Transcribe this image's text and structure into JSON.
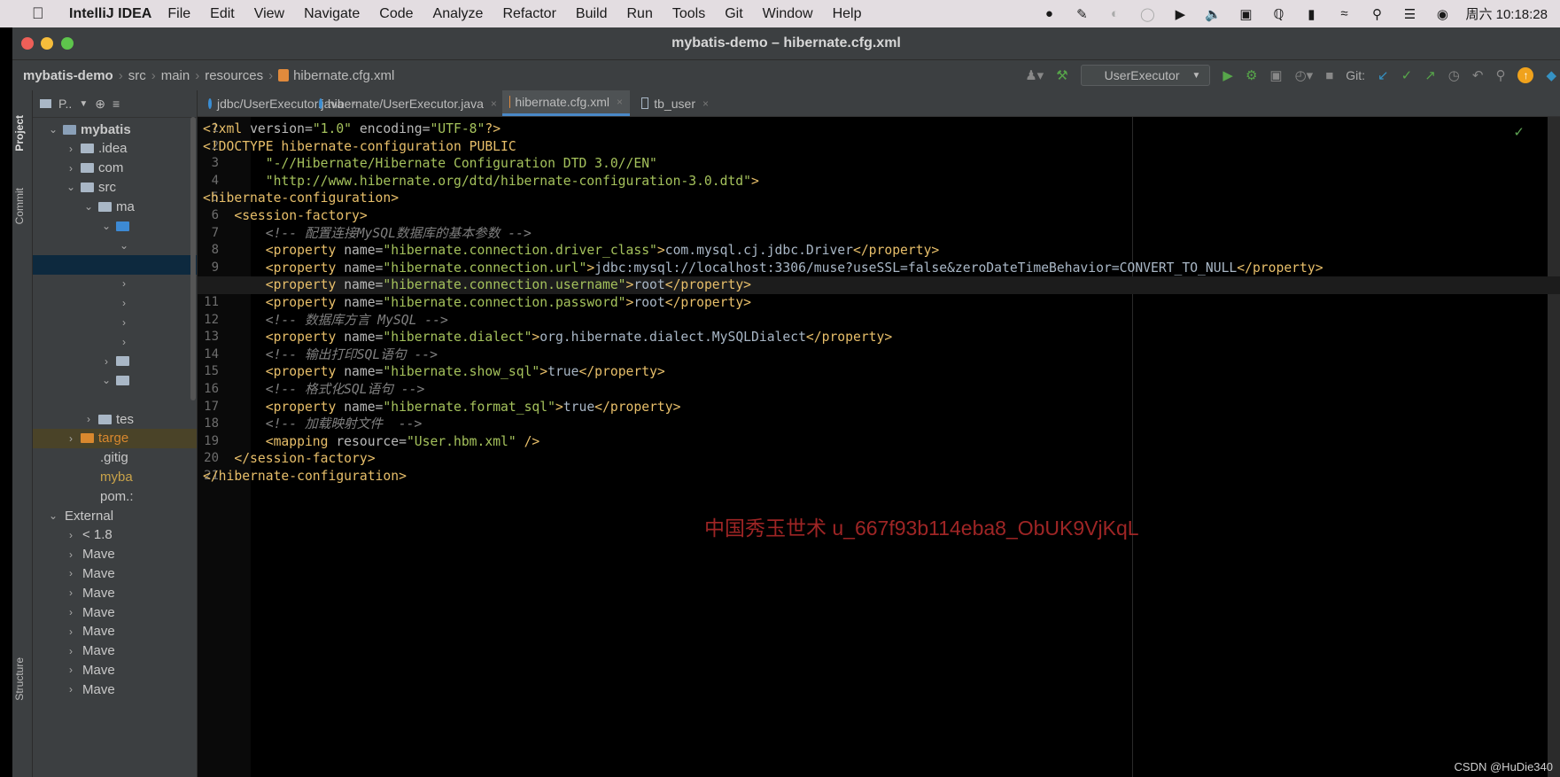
{
  "menubar": {
    "app": "IntelliJ IDEA",
    "items": [
      "File",
      "Edit",
      "View",
      "Navigate",
      "Code",
      "Analyze",
      "Refactor",
      "Build",
      "Run",
      "Tools",
      "Git",
      "Window",
      "Help"
    ],
    "clock": "周六 10:18:28"
  },
  "window": {
    "title": "mybatis-demo – hibernate.cfg.xml",
    "breadcrumbs": [
      "mybatis-demo",
      "src",
      "main",
      "resources",
      "hibernate.cfg.xml"
    ],
    "run_config": "UserExecutor",
    "git_label": "Git:"
  },
  "left_strip": {
    "project": "Project",
    "commit": "Commit",
    "structure": "Structure"
  },
  "project_panel": {
    "header": "P..",
    "rows": [
      {
        "label": "mybatis",
        "arrow": "v",
        "indent": 1,
        "folder": "mod"
      },
      {
        "label": ".idea",
        "arrow": ">",
        "indent": 2,
        "folder": "plain"
      },
      {
        "label": "com",
        "arrow": ">",
        "indent": 2,
        "folder": "plain"
      },
      {
        "label": "src",
        "arrow": "v",
        "indent": 2,
        "folder": "plain"
      },
      {
        "label": "ma",
        "arrow": "v",
        "indent": 3,
        "folder": "plain"
      },
      {
        "label": "",
        "arrow": "v",
        "indent": 4,
        "folder": "blue"
      },
      {
        "label": "",
        "arrow": "v",
        "indent": 5,
        "folder": "none"
      },
      {
        "label": "",
        "arrow": "",
        "indent": 5,
        "folder": "none"
      },
      {
        "label": "",
        "arrow": ">",
        "indent": 5,
        "folder": "none"
      },
      {
        "label": "",
        "arrow": ">",
        "indent": 5,
        "folder": "none"
      },
      {
        "label": "",
        "arrow": ">",
        "indent": 5,
        "folder": "none"
      },
      {
        "label": "",
        "arrow": ">",
        "indent": 5,
        "folder": "none"
      },
      {
        "label": "",
        "arrow": ">",
        "indent": 4,
        "folder": "plain"
      },
      {
        "label": "",
        "arrow": "v",
        "indent": 4,
        "folder": "plain"
      },
      {
        "label": "",
        "arrow": "",
        "indent": 4,
        "folder": "none"
      },
      {
        "label": "tes",
        "arrow": ">",
        "indent": 3,
        "folder": "plain"
      },
      {
        "label": "targe",
        "arrow": ">",
        "indent": 2,
        "folder": "orange"
      },
      {
        "label": ".gitig",
        "arrow": "",
        "indent": 3,
        "folder": "none"
      },
      {
        "label": "myba",
        "arrow": "",
        "indent": 3,
        "folder": "none"
      },
      {
        "label": "pom.:",
        "arrow": "",
        "indent": 3,
        "folder": "none"
      },
      {
        "label": "External",
        "arrow": "v",
        "indent": 1,
        "folder": "none"
      },
      {
        "label": "< 1.8",
        "arrow": ">",
        "indent": 2,
        "folder": "none"
      },
      {
        "label": "Mave",
        "arrow": ">",
        "indent": 2,
        "folder": "none"
      },
      {
        "label": "Mave",
        "arrow": ">",
        "indent": 2,
        "folder": "none"
      },
      {
        "label": "Mave",
        "arrow": ">",
        "indent": 2,
        "folder": "none"
      },
      {
        "label": "Mave",
        "arrow": ">",
        "indent": 2,
        "folder": "none"
      },
      {
        "label": "Mave",
        "arrow": ">",
        "indent": 2,
        "folder": "none"
      },
      {
        "label": "Mave",
        "arrow": ">",
        "indent": 2,
        "folder": "none"
      },
      {
        "label": "Mave",
        "arrow": ">",
        "indent": 2,
        "folder": "none"
      },
      {
        "label": "Mave",
        "arrow": ">",
        "indent": 2,
        "folder": "none"
      }
    ]
  },
  "tabs": [
    {
      "label": "jdbc/UserExecutor.java",
      "type": "java",
      "active": false
    },
    {
      "label": "hibernate/UserExecutor.java",
      "type": "java",
      "active": false
    },
    {
      "label": "hibernate.cfg.xml",
      "type": "xml",
      "active": true
    },
    {
      "label": "tb_user",
      "type": "table",
      "active": false
    }
  ],
  "editor": {
    "current_line": 10,
    "lines": [
      [
        [
          "tag",
          "<?xml "
        ],
        [
          "attr",
          "version="
        ],
        [
          "val",
          "\"1.0\""
        ],
        [
          "attr",
          " encoding="
        ],
        [
          "val",
          "\"UTF-8\""
        ],
        [
          "tag",
          "?>"
        ]
      ],
      [
        [
          "tag",
          "<!DOCTYPE hibernate-configuration PUBLIC"
        ]
      ],
      [
        [
          "txt",
          "        "
        ],
        [
          "val",
          "\"-//Hibernate/Hibernate Configuration DTD 3.0//EN\""
        ]
      ],
      [
        [
          "txt",
          "        "
        ],
        [
          "val",
          "\"http://www.hibernate.org/dtd/hibernate-configuration-3.0.dtd\""
        ],
        [
          "tag",
          ">"
        ]
      ],
      [
        [
          "tag",
          "<hibernate-configuration>"
        ]
      ],
      [
        [
          "txt",
          "    "
        ],
        [
          "tag",
          "<session-factory>"
        ]
      ],
      [
        [
          "txt",
          "        "
        ],
        [
          "cm",
          "<!-- 配置连接MySQL数据库的基本参数 -->"
        ]
      ],
      [
        [
          "txt",
          "        "
        ],
        [
          "tag",
          "<property "
        ],
        [
          "attr",
          "name="
        ],
        [
          "val",
          "\"hibernate.connection.driver_class\""
        ],
        [
          "tag",
          ">"
        ],
        [
          "txt",
          "com.mysql.cj.jdbc.Driver"
        ],
        [
          "tag",
          "</property>"
        ]
      ],
      [
        [
          "txt",
          "        "
        ],
        [
          "tag",
          "<property "
        ],
        [
          "attr",
          "name="
        ],
        [
          "val",
          "\"hibernate.connection.url\""
        ],
        [
          "tag",
          ">"
        ],
        [
          "txt",
          "jdbc:mysql://localhost:3306/muse?useSSL=false&zeroDateTimeBehavior=CONVERT_TO_NULL"
        ],
        [
          "tag",
          "</property>"
        ]
      ],
      [
        [
          "txt",
          "        "
        ],
        [
          "tag",
          "<property "
        ],
        [
          "attr",
          "name="
        ],
        [
          "val",
          "\"hibernate.connection.username\""
        ],
        [
          "tag",
          ">"
        ],
        [
          "txt",
          "root"
        ],
        [
          "tag",
          "</property>"
        ]
      ],
      [
        [
          "txt",
          "        "
        ],
        [
          "tag",
          "<property "
        ],
        [
          "attr",
          "name="
        ],
        [
          "val",
          "\"hibernate.connection.password\""
        ],
        [
          "tag",
          ">"
        ],
        [
          "txt",
          "root"
        ],
        [
          "tag",
          "</property>"
        ]
      ],
      [
        [
          "txt",
          "        "
        ],
        [
          "cm",
          "<!-- 数据库方言 MySQL -->"
        ]
      ],
      [
        [
          "txt",
          "        "
        ],
        [
          "tag",
          "<property "
        ],
        [
          "attr",
          "name="
        ],
        [
          "val",
          "\"hibernate.dialect\""
        ],
        [
          "tag",
          ">"
        ],
        [
          "txt",
          "org.hibernate.dialect.MySQLDialect"
        ],
        [
          "tag",
          "</property>"
        ]
      ],
      [
        [
          "txt",
          "        "
        ],
        [
          "cm",
          "<!-- 输出打印SQL语句 -->"
        ]
      ],
      [
        [
          "txt",
          "        "
        ],
        [
          "tag",
          "<property "
        ],
        [
          "attr",
          "name="
        ],
        [
          "val",
          "\"hibernate.show_sql\""
        ],
        [
          "tag",
          ">"
        ],
        [
          "txt",
          "true"
        ],
        [
          "tag",
          "</property>"
        ]
      ],
      [
        [
          "txt",
          "        "
        ],
        [
          "cm",
          "<!-- 格式化SQL语句 -->"
        ]
      ],
      [
        [
          "txt",
          "        "
        ],
        [
          "tag",
          "<property "
        ],
        [
          "attr",
          "name="
        ],
        [
          "val",
          "\"hibernate.format_sql\""
        ],
        [
          "tag",
          ">"
        ],
        [
          "txt",
          "true"
        ],
        [
          "tag",
          "</property>"
        ]
      ],
      [
        [
          "txt",
          "        "
        ],
        [
          "cm",
          "<!-- 加载映射文件  -->"
        ]
      ],
      [
        [
          "txt",
          "        "
        ],
        [
          "tag",
          "<mapping "
        ],
        [
          "attr",
          "resource="
        ],
        [
          "val",
          "\"User.hbm.xml\""
        ],
        [
          "tag",
          " />"
        ]
      ],
      [
        [
          "txt",
          "    "
        ],
        [
          "tag",
          "</session-factory>"
        ]
      ],
      [
        [
          "tag",
          "</hibernate-configuration>"
        ]
      ]
    ]
  },
  "overlay": {
    "watermark": "中国秀玉世术 u_667f93b114eba8_ObUK9VjKqL",
    "csdn": "CSDN @HuDie340"
  },
  "colors": {
    "accent": "#4a88c7",
    "xml_tag": "#e8bf6a",
    "xml_value": "#a5c25c",
    "comment": "#808080"
  }
}
